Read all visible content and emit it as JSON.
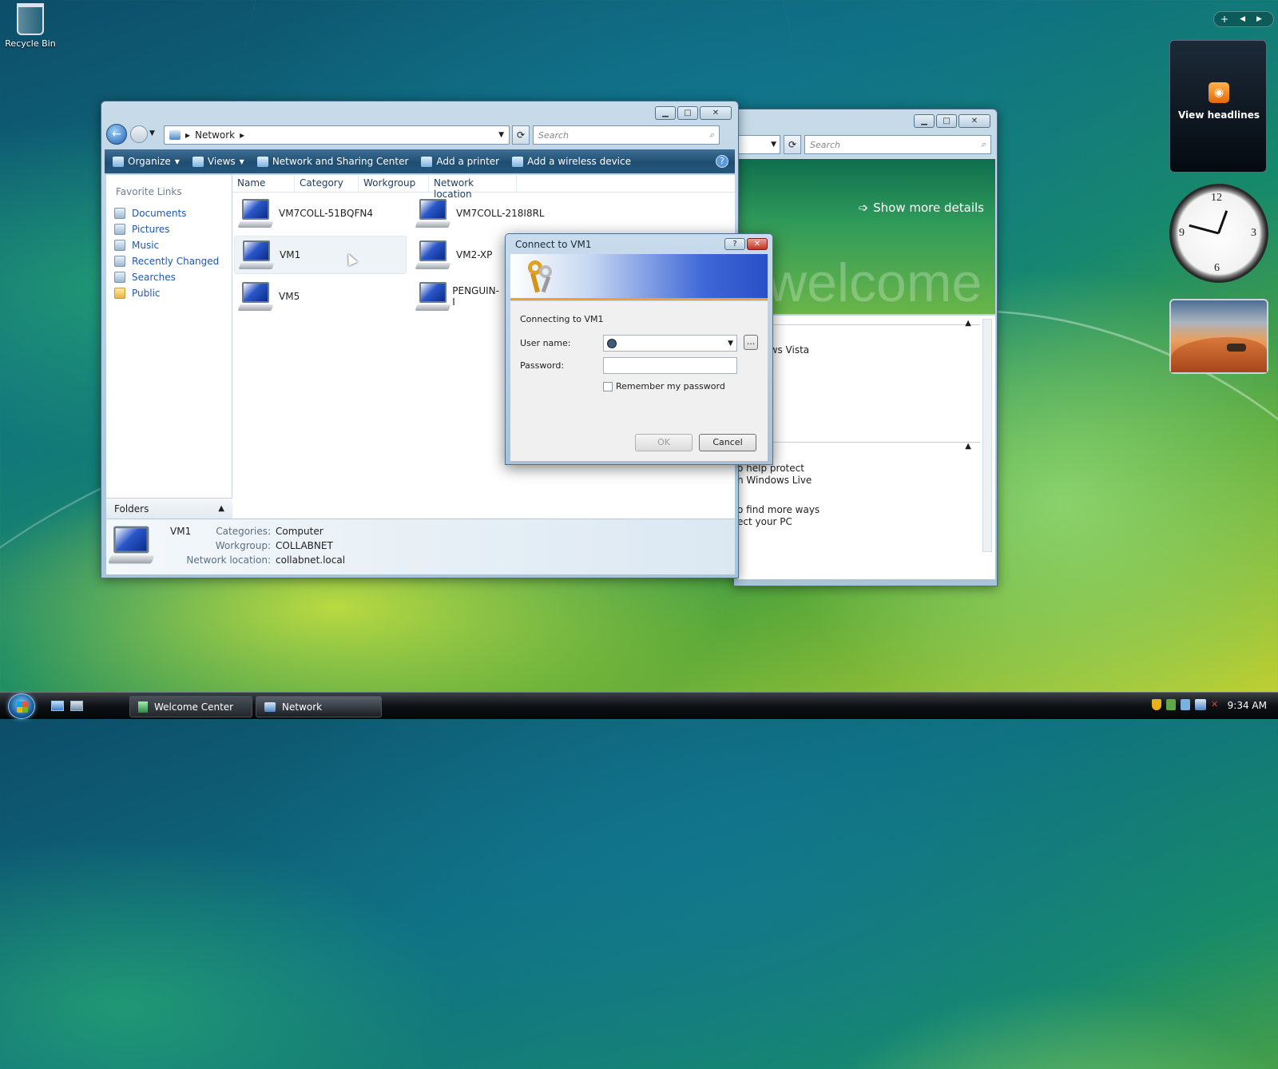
{
  "desktop": {
    "recycle_bin_label": "Recycle Bin"
  },
  "explorer": {
    "breadcrumb": "Network",
    "search_placeholder": "Search",
    "toolbar": {
      "organize": "Organize",
      "views": "Views",
      "network_sharing": "Network and Sharing Center",
      "add_printer": "Add a printer",
      "add_wireless": "Add a wireless device"
    },
    "favorite_links": {
      "title": "Favorite Links",
      "items": [
        "Documents",
        "Pictures",
        "Music",
        "Recently Changed",
        "Searches",
        "Public"
      ]
    },
    "columns": [
      "Name",
      "Category",
      "Workgroup",
      "Network location"
    ],
    "computers": [
      "VM7COLL-51BQFN4",
      "VM7COLL-218I8RL",
      "VM1",
      "VM2-XP",
      "VM5",
      "PENGUIN-I"
    ],
    "folders_label": "Folders",
    "details": {
      "name": "VM1",
      "categories_label": "Categories:",
      "categories_value": "Computer",
      "workgroup_label": "Workgroup:",
      "workgroup_value": "COLLABNET",
      "location_label": "Network location:",
      "location_value": "collabnet.local"
    }
  },
  "welcome": {
    "search_placeholder": "Search",
    "show_more": "Show more details",
    "banner_text": "welcome",
    "text1": "lows Vista",
    "text2": "o help protect",
    "text3": "h Windows Live",
    "text4": "o find more ways",
    "text5": "ect your PC"
  },
  "dialog": {
    "title": "Connect to VM1",
    "connecting": "Connecting to VM1",
    "username_label": "User name:",
    "password_label": "Password:",
    "remember": "Remember my password",
    "ok": "OK",
    "cancel": "Cancel",
    "browse": "..."
  },
  "sidebar": {
    "headlines": "View headlines"
  },
  "taskbar": {
    "tasks": [
      "Welcome Center",
      "Network"
    ],
    "clock": "9:34 AM"
  }
}
